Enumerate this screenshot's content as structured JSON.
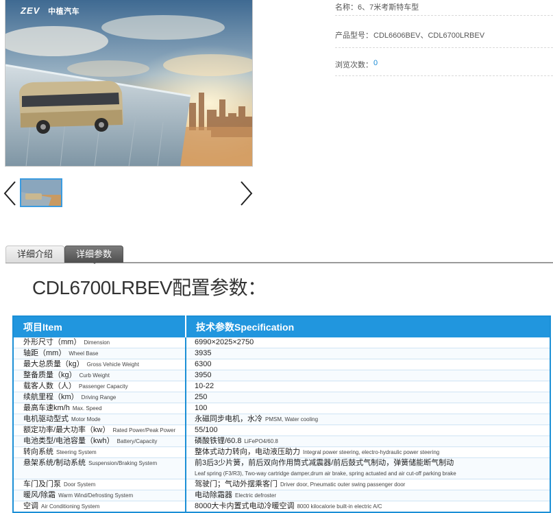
{
  "product": {
    "logo_brand": "ZEV",
    "logo_company": "中植汽车",
    "name_label": "名称：",
    "name_value": "6、7米考斯特车型",
    "model_label": "产品型号：",
    "model_value": "CDL6606BEV、CDL6700LRBEV",
    "views_label": "浏览次数：",
    "views_value": "0"
  },
  "gallery": {
    "prev_icon": "chevron-left-icon",
    "next_icon": "chevron-right-icon",
    "thumb_count": 1
  },
  "tabs": [
    {
      "label": "详细介绍",
      "active": false
    },
    {
      "label": "详细参数",
      "active": true
    }
  ],
  "spec_heading": "CDL6700LRBEV配置参数：",
  "spec_table": {
    "header_item": "项目Item",
    "header_spec": "技术参数Specification",
    "rows": [
      {
        "item_cn": "外形尺寸（mm）",
        "item_en": "Dimension",
        "spec": "6990×2025×2750",
        "spec_en": ""
      },
      {
        "item_cn": "轴距（mm）",
        "item_en": "Wheel Base",
        "spec": "3935",
        "spec_en": ""
      },
      {
        "item_cn": "最大总质量（kg）",
        "item_en": "Gross Vehicle Weight",
        "spec": "6300",
        "spec_en": ""
      },
      {
        "item_cn": "整备质量（kg）",
        "item_en": "Curb Weight",
        "spec": "3950",
        "spec_en": ""
      },
      {
        "item_cn": "载客人数（人）",
        "item_en": "Passenger Capacity",
        "spec": "10-22",
        "spec_en": ""
      },
      {
        "item_cn": "续航里程（km）",
        "item_en": "Driving Range",
        "spec": "250",
        "spec_en": ""
      },
      {
        "item_cn": "最高车速km/h",
        "item_en": "Max. Speed",
        "spec": "100",
        "spec_en": ""
      },
      {
        "item_cn": "电机驱动型式",
        "item_en": "Motor Mode",
        "spec": "永磁同步电机，水冷",
        "spec_en": "PMSM, Water cooling"
      },
      {
        "item_cn": "额定功率/最大功率（kw）",
        "item_en": "Rated Power/Peak Power",
        "spec": "55/100",
        "spec_en": ""
      },
      {
        "item_cn": "电池类型/电池容量（kwh）",
        "item_en": "Battery/Capacity",
        "spec": "磷酸铁锂/60.8",
        "spec_en": "LiFePO4/60.8"
      },
      {
        "item_cn": "转向系统",
        "item_en": "Steering System",
        "spec": "整体式动力转向，电动液压助力",
        "spec_en": "Integral power steering, electro-hydraulic power steering"
      },
      {
        "item_cn": "悬架系统/制动系统",
        "item_en": "Suspension/Braking System",
        "spec": "前3后3少片簧，前后双向作用筒式减震器/前后鼓式气制动，弹簧储能断气制动",
        "spec_en": "",
        "spec_line2": "Leaf spring (F3/R3), Two-way cartridge damper,drum air brake, spring actuated and air cut-off parking brake"
      },
      {
        "item_cn": "车门及门泵",
        "item_en": "Door System",
        "spec": "驾驶门；气动外摆乘客门",
        "spec_en": "Driver door, Pneumatic outer swing passenger door"
      },
      {
        "item_cn": "暖风/除霜",
        "item_en": "Warm Wind/Defrosting System",
        "spec": "电动除霜器",
        "spec_en": "Electric defroster"
      },
      {
        "item_cn": "空调",
        "item_en": "Air Conditioning System",
        "spec": "8000大卡内置式电动冷暖空调",
        "spec_en": "8000 kilocalorie built-in electric A/C"
      }
    ]
  },
  "colors": {
    "table_header": "#2196de",
    "table_border": "#1b8fd6",
    "link": "#1a8ad4",
    "active_tab": "#5f5f5f"
  }
}
